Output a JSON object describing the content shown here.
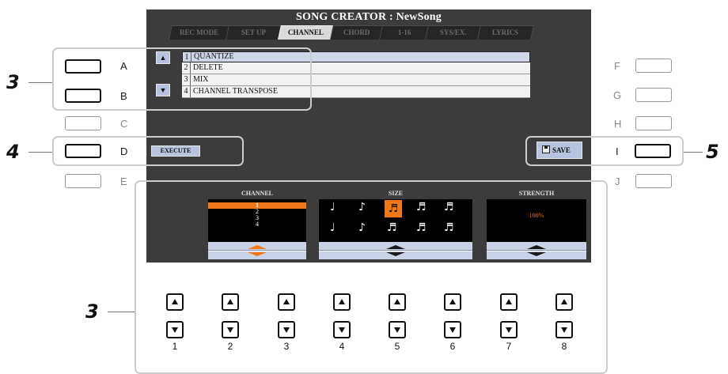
{
  "screen": {
    "title": "SONG CREATOR : NewSong",
    "tabs": [
      "REC MODE",
      "SET UP",
      "CHANNEL",
      "CHORD",
      "1-16",
      "SYS/EX.",
      "LYRICS"
    ],
    "active_tab": "CHANNEL",
    "menu": [
      {
        "num": "1",
        "label": "QUANTIZE"
      },
      {
        "num": "2",
        "label": "DELETE"
      },
      {
        "num": "3",
        "label": "MIX"
      },
      {
        "num": "4",
        "label": "CHANNEL TRANSPOSE"
      }
    ],
    "execute_label": "EXECUTE",
    "save_label": "SAVE",
    "channel": {
      "label": "CHANNEL",
      "items": [
        "1",
        "2",
        "3",
        "4"
      ],
      "selected": "1"
    },
    "size": {
      "label": "SIZE",
      "notes_top": [
        "♩",
        "♪",
        "♬",
        "♬",
        "♬"
      ],
      "notes_bottom": [
        "♩",
        "♪",
        "♬",
        "♬",
        "♬"
      ],
      "selected_index": 2
    },
    "strength": {
      "label": "STRENGTH",
      "value": "100%"
    }
  },
  "hardware": {
    "left_letters": [
      "A",
      "B",
      "C",
      "D",
      "E"
    ],
    "right_letters": [
      "F",
      "G",
      "H",
      "I",
      "J"
    ],
    "dial_numbers": [
      "1",
      "2",
      "3",
      "4",
      "5",
      "6",
      "7",
      "8"
    ]
  },
  "steps": {
    "menu": "3",
    "execute": "4",
    "save": "5",
    "dials": "3"
  },
  "colors": {
    "screen_bg": "#3c3c3c",
    "accent": "#f07818",
    "button_fill": "#b8c4dd"
  }
}
